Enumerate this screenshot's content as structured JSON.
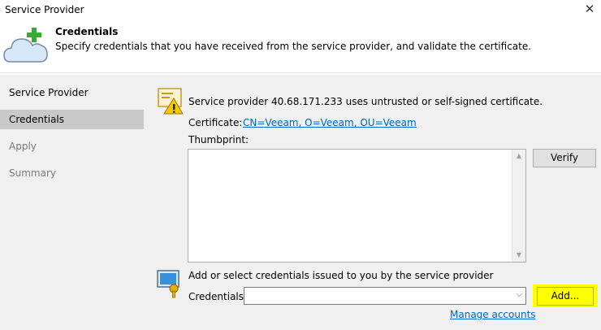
{
  "window": {
    "title": "Service Provider",
    "close_glyph": "✕"
  },
  "header": {
    "icon": "cloud-add-icon",
    "title": "Credentials",
    "description": "Specify credentials that you have received from the service provider, and validate the certificate."
  },
  "steps": [
    {
      "label": "Service Provider",
      "state": "done"
    },
    {
      "label": "Credentials",
      "state": "active"
    },
    {
      "label": "Apply",
      "state": "future"
    },
    {
      "label": "Summary",
      "state": "future"
    }
  ],
  "certificate": {
    "icon": "certificate-warning-icon",
    "warning": "Service provider 40.68.171.233 uses untrusted or self-signed certificate.",
    "label": "Certificate:",
    "link": "CN=Veeam, O=Veeam, OU=Veeam",
    "thumbprint_label": "Thumbprint:",
    "thumbprint_value": "",
    "verify_label": "Verify"
  },
  "credentials": {
    "icon": "credentials-key-icon",
    "info": "Add or select credentials issued to you by the service provider",
    "label": "Credentials:",
    "selected": "",
    "add_label": "Add...",
    "manage_label": "Manage accounts"
  },
  "colors": {
    "accent_link": "#0066cc",
    "highlight": "#ffff00",
    "active_step": "#c9c9c9",
    "panel_bg": "#f0f0f0"
  }
}
